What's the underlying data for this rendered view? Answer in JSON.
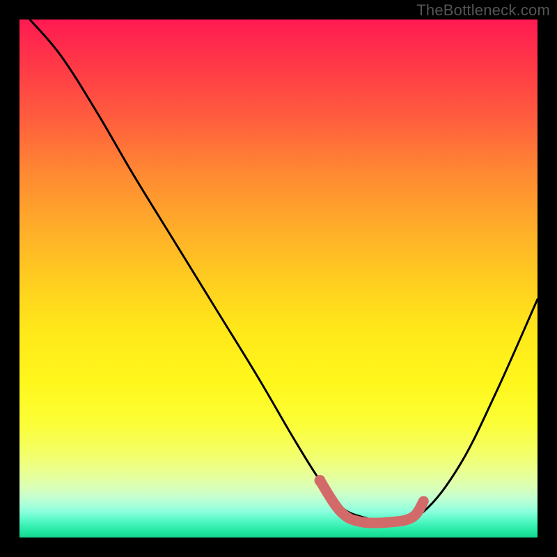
{
  "watermark": "TheBottleneck.com",
  "chart_data": {
    "type": "line",
    "title": "",
    "xlabel": "",
    "ylabel": "",
    "xlim": [
      0,
      100
    ],
    "ylim": [
      0,
      100
    ],
    "series": [
      {
        "name": "main-curve",
        "color": "#000000",
        "x": [
          2,
          8,
          15,
          22,
          30,
          38,
          46,
          53,
          58,
          62,
          66,
          72,
          78,
          85,
          92,
          100
        ],
        "y": [
          100,
          93,
          82,
          70,
          57,
          44,
          31,
          19,
          11,
          6,
          4,
          3,
          5,
          14,
          28,
          46
        ]
      },
      {
        "name": "highlight-segment",
        "color": "#d36a6a",
        "x": [
          58,
          62,
          66,
          72,
          76,
          78
        ],
        "y": [
          11,
          5,
          3,
          3,
          4,
          7
        ]
      }
    ]
  }
}
